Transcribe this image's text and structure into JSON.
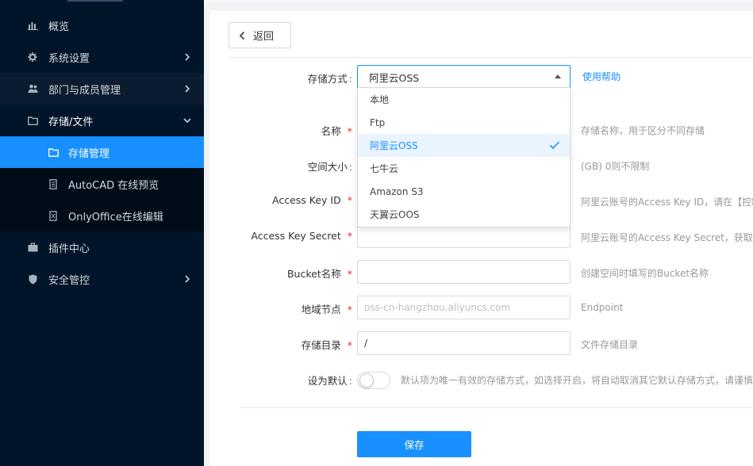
{
  "sidebar": {
    "items": [
      {
        "label": "概览",
        "icon": "bar-chart-icon"
      },
      {
        "label": "系统设置",
        "icon": "gear-icon"
      },
      {
        "label": "部门与成员管理",
        "icon": "users-icon"
      },
      {
        "label": "存储/文件",
        "icon": "folder-icon"
      },
      {
        "label": "插件中心",
        "icon": "briefcase-icon"
      },
      {
        "label": "安全管控",
        "icon": "shield-icon"
      }
    ],
    "sub_items": [
      {
        "label": "存储管理",
        "icon": "folder-icon"
      },
      {
        "label": "AutoCAD 在线预览",
        "icon": "document-icon"
      },
      {
        "label": "OnlyOffice在线编辑",
        "icon": "spreadsheet-file-icon"
      }
    ]
  },
  "toolbar": {
    "back_label": "返回"
  },
  "form": {
    "storage_type_label": "存储方式",
    "storage_type_value": "阿里云OSS",
    "help_link": "使用帮助",
    "name_label": "名称",
    "name_hint": "存储名称，用于区分不同存储",
    "size_label": "空间大小",
    "size_hint": "(GB) 0则不限制",
    "access_key_id_label": "Access Key ID",
    "access_key_id_hint": "阿里云账号的Access Key ID，请在【控制",
    "access_key_secret_label": "Access Key Secret",
    "access_key_secret_hint": "阿里云账号的Access Key Secret，获取方",
    "bucket_label": "Bucket名称",
    "bucket_hint": "创建空间时填写的Bucket名称",
    "region_label": "地域节点",
    "region_placeholder": "oss-cn-hangzhou.aliyuncs.com",
    "region_hint": "Endpoint",
    "dir_label": "存储目录",
    "dir_value": "/",
    "dir_hint": "文件存储目录",
    "default_label": "设为默认",
    "default_hint": "默认项为唯一有效的存储方式，如选择开启，将自动取消其它默认存储方式，请谨慎",
    "default_on": false,
    "save_label": "保存"
  },
  "dropdown": {
    "options": [
      "本地",
      "Ftp",
      "阿里云OSS",
      "七牛云",
      "Amazon S3",
      "天翼云OOS"
    ],
    "selected": "阿里云OSS"
  },
  "colors": {
    "primary": "#1890ff",
    "sidebar_bg": "#001529",
    "required": "#f5222d"
  }
}
